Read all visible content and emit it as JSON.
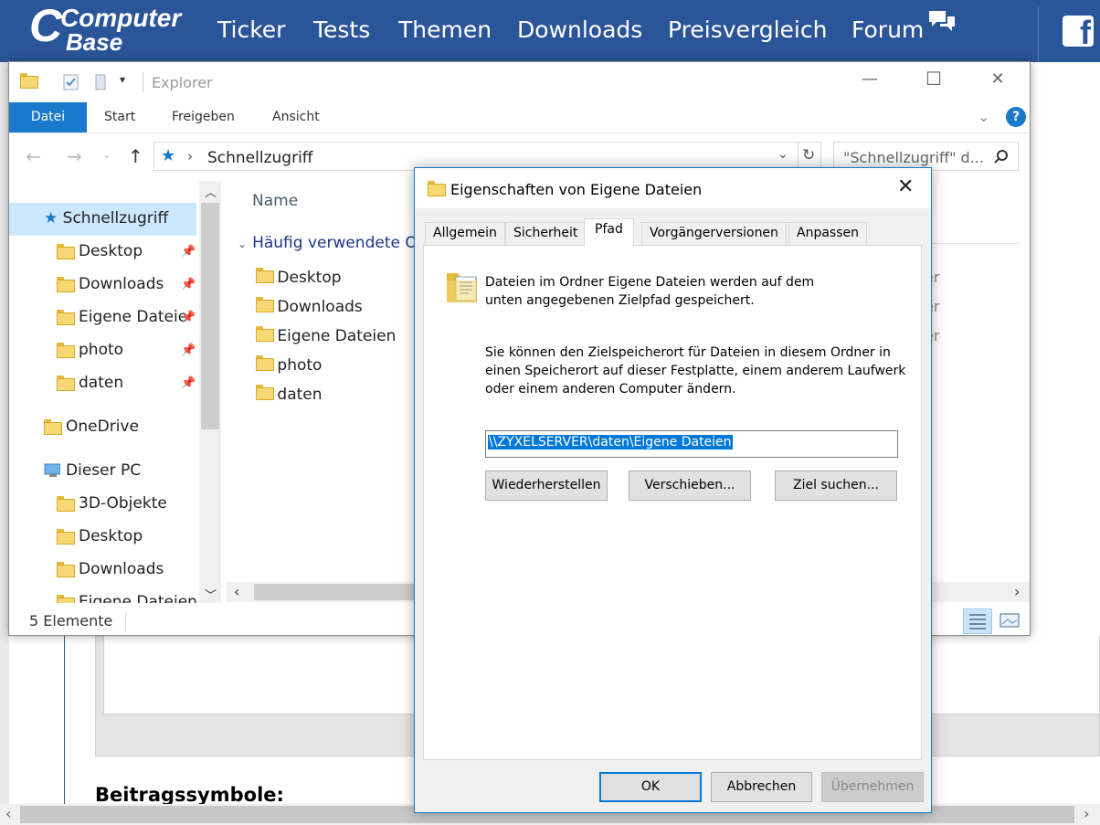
{
  "site": {
    "logo_top": "Computer",
    "logo_bottom": "Base",
    "nav": [
      "Ticker",
      "Tests",
      "Themen",
      "Downloads",
      "Preisvergleich",
      "Forum"
    ],
    "heading": "Beitragssymbole:",
    "brand_color": "#2b5599",
    "facebook_icon": "facebook-icon"
  },
  "explorer": {
    "title": "Explorer",
    "ribbon_tabs": [
      "Datei",
      "Start",
      "Freigeben",
      "Ansicht"
    ],
    "address": "Schnellzugriff",
    "search_placeholder": "\"Schnellzugriff\" d...",
    "sidebar": {
      "quick_access": "Schnellzugriff",
      "pinned": [
        "Desktop",
        "Downloads",
        "Eigene Dateie",
        "photo",
        "daten"
      ],
      "onedrive": "OneDrive",
      "this_pc": "Dieser PC",
      "pc_items": [
        "3D-Objekte",
        "Desktop",
        "Downloads",
        "Eigene Dateien"
      ]
    },
    "column_name": "Name",
    "group_header": "Häufig verwendete Or",
    "files": [
      "Desktop",
      "Downloads",
      "Eigene Dateien",
      "photo",
      "daten"
    ],
    "right_column_fragment": [
      "er",
      "er",
      "er"
    ],
    "status": "5 Elemente",
    "accent_color": "#1979ca"
  },
  "dialog": {
    "title": "Eigenschaften von Eigene Dateien",
    "tabs": [
      "Allgemein",
      "Sicherheit",
      "Pfad",
      "Vorgängerversionen",
      "Anpassen"
    ],
    "active_tab": "Pfad",
    "intro_line1": "Dateien im Ordner Eigene Dateien werden auf dem",
    "intro_line2": "unten angegebenen Zielpfad gespeichert.",
    "desc_line1": "Sie können den Zielspeicherort für Dateien in diesem Ordner in",
    "desc_line2": "einen Speicherort auf dieser Festplatte, einem anderem Laufwerk",
    "desc_line3": "oder einem anderen Computer ändern.",
    "path_value": "\\\\ZYXELSERVER\\daten\\Eigene Dateien",
    "buttons": {
      "restore": "Wiederherstellen",
      "move": "Verschieben...",
      "find": "Ziel suchen...",
      "ok": "OK",
      "cancel": "Abbrechen",
      "apply": "Übernehmen"
    }
  }
}
